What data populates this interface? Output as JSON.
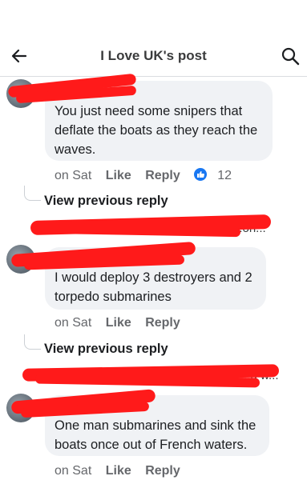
{
  "header": {
    "title": "I Love  UK's post"
  },
  "comments": [
    {
      "text_lines": [
        "You just need some snipers that",
        "deflate the boats as they reach the",
        "waves."
      ],
      "time": "on Sat",
      "like": "Like",
      "reply": "Reply",
      "reaction_count": "12"
    },
    {
      "text_lines": [
        "I would deploy 3 destroyers and 2",
        "torpedo submarines"
      ],
      "time": "on Sat",
      "like": "Like",
      "reply": "Reply"
    },
    {
      "text_lines": [
        "One man submarines and sink the",
        "boats once out of French waters."
      ],
      "time": "on Sat",
      "like": "Like",
      "reply": "Reply"
    }
  ],
  "view_previous": [
    "View previous reply",
    "View previous reply"
  ],
  "reply_previews": [
    "...oh...",
    "...g w..."
  ],
  "colors": {
    "redaction": "#ff1a1a",
    "like_blue": "#1877f2",
    "bubble": "#f0f2f5"
  }
}
